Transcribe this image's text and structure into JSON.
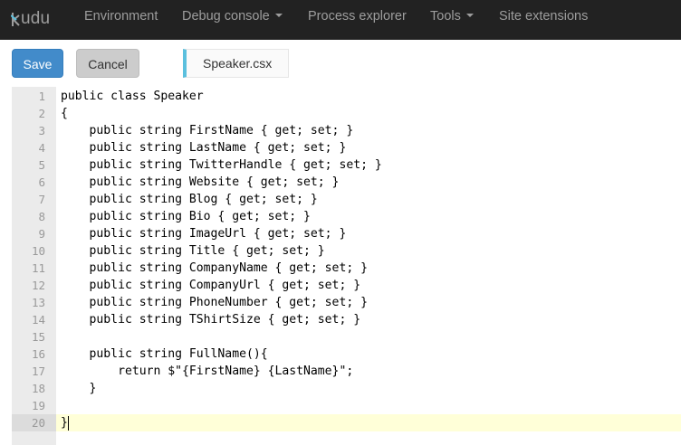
{
  "navbar": {
    "brand": "udu",
    "items": [
      {
        "label": "Environment",
        "dropdown": false
      },
      {
        "label": "Debug console",
        "dropdown": true
      },
      {
        "label": "Process explorer",
        "dropdown": false
      },
      {
        "label": "Tools",
        "dropdown": true
      },
      {
        "label": "Site extensions",
        "dropdown": false
      }
    ]
  },
  "toolbar": {
    "save_label": "Save",
    "cancel_label": "Cancel",
    "file_tab": "Speaker.csx"
  },
  "editor": {
    "active_line": 20,
    "lines": [
      "public class Speaker",
      "{",
      "    public string FirstName { get; set; }",
      "    public string LastName { get; set; }",
      "    public string TwitterHandle { get; set; }",
      "    public string Website { get; set; }",
      "    public string Blog { get; set; }",
      "    public string Bio { get; set; }",
      "    public string ImageUrl { get; set; }",
      "    public string Title { get; set; }",
      "    public string CompanyName { get; set; }",
      "    public string CompanyUrl { get; set; }",
      "    public string PhoneNumber { get; set; }",
      "    public string TShirtSize { get; set; }",
      "",
      "    public string FullName(){",
      "        return $\"{FirstName} {LastName}\";",
      "    }",
      "",
      "}"
    ]
  },
  "colors": {
    "navbar_bg": "#222222",
    "save_button": "#428bca",
    "file_tab_accent": "#5bc0de",
    "active_line_bg": "#ffffd8"
  }
}
